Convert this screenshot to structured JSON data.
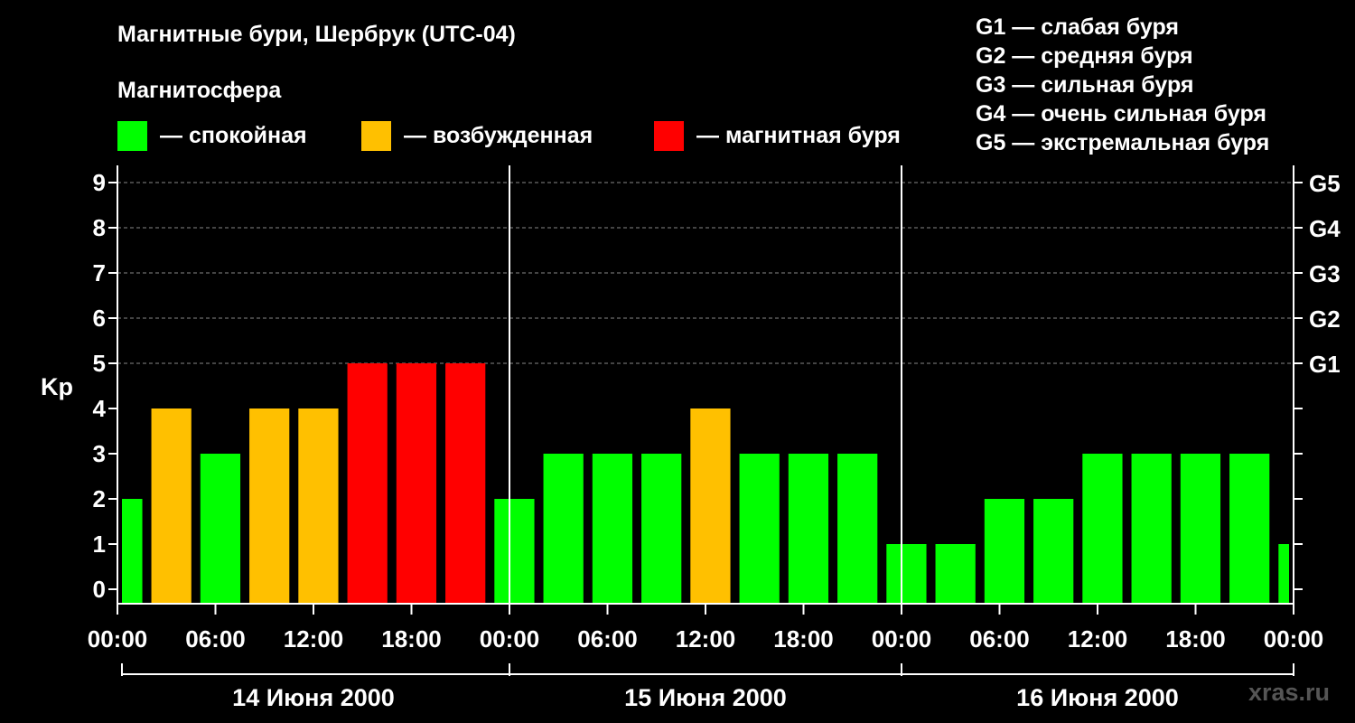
{
  "chart_data": {
    "type": "bar",
    "title": "Магнитные бури, Шербрук (UTC-04)",
    "subtitle": "Магнитосфера",
    "ylabel": "Kp",
    "ylim": [
      -0.3,
      9.3
    ],
    "yticks": [
      "0",
      "1",
      "2",
      "3",
      "4",
      "5",
      "6",
      "7",
      "8",
      "9"
    ],
    "g_ticks": [
      {
        "kp": 5,
        "label": "G1"
      },
      {
        "kp": 6,
        "label": "G2"
      },
      {
        "kp": 7,
        "label": "G3"
      },
      {
        "kp": 8,
        "label": "G4"
      },
      {
        "kp": 9,
        "label": "G5"
      }
    ],
    "xrange_hours": [
      0,
      72
    ],
    "xticks": [
      "00:00",
      "06:00",
      "12:00",
      "18:00",
      "00:00",
      "06:00",
      "12:00",
      "18:00",
      "00:00",
      "06:00",
      "12:00",
      "18:00",
      "00:00"
    ],
    "days": [
      "14 Июня 2000",
      "15 Июня 2000",
      "16 Июня 2000"
    ],
    "grid": "dashed horizontal at Kp 5–9",
    "colors": {
      "quiet": "#00ff00",
      "active": "#ffc000",
      "storm": "#ff0000"
    },
    "legend": [
      {
        "status": "quiet",
        "label": "— спокойная"
      },
      {
        "status": "active",
        "label": "— возбужденная"
      },
      {
        "status": "storm",
        "label": "— магнитная буря"
      }
    ],
    "bars": [
      {
        "start": 0,
        "end": 1.8,
        "kp": 2
      },
      {
        "start": 1.8,
        "end": 4.8,
        "kp": 4
      },
      {
        "start": 4.8,
        "end": 7.8,
        "kp": 3
      },
      {
        "start": 7.8,
        "end": 10.8,
        "kp": 4
      },
      {
        "start": 10.8,
        "end": 13.8,
        "kp": 4
      },
      {
        "start": 13.8,
        "end": 16.8,
        "kp": 5
      },
      {
        "start": 16.8,
        "end": 19.8,
        "kp": 5
      },
      {
        "start": 19.8,
        "end": 22.8,
        "kp": 5
      },
      {
        "start": 22.8,
        "end": 25.8,
        "kp": 2
      },
      {
        "start": 25.8,
        "end": 28.8,
        "kp": 3
      },
      {
        "start": 28.8,
        "end": 31.8,
        "kp": 3
      },
      {
        "start": 31.8,
        "end": 34.8,
        "kp": 3
      },
      {
        "start": 34.8,
        "end": 37.8,
        "kp": 4
      },
      {
        "start": 37.8,
        "end": 40.8,
        "kp": 3
      },
      {
        "start": 40.8,
        "end": 43.8,
        "kp": 3
      },
      {
        "start": 43.8,
        "end": 46.8,
        "kp": 3
      },
      {
        "start": 46.8,
        "end": 49.8,
        "kp": 1
      },
      {
        "start": 49.8,
        "end": 52.8,
        "kp": 1
      },
      {
        "start": 52.8,
        "end": 55.8,
        "kp": 2
      },
      {
        "start": 55.8,
        "end": 58.8,
        "kp": 2
      },
      {
        "start": 58.8,
        "end": 61.8,
        "kp": 3
      },
      {
        "start": 61.8,
        "end": 64.8,
        "kp": 3
      },
      {
        "start": 64.8,
        "end": 67.8,
        "kp": 3
      },
      {
        "start": 67.8,
        "end": 70.8,
        "kp": 3
      },
      {
        "start": 70.8,
        "end": 72,
        "kp": 1
      }
    ]
  },
  "storm_scale": [
    "G1 — слабая буря",
    "G2 — средняя буря",
    "G3 — сильная буря",
    "G4 — очень сильная буря",
    "G5 — экстремальная буря"
  ],
  "watermark": "xras.ru"
}
